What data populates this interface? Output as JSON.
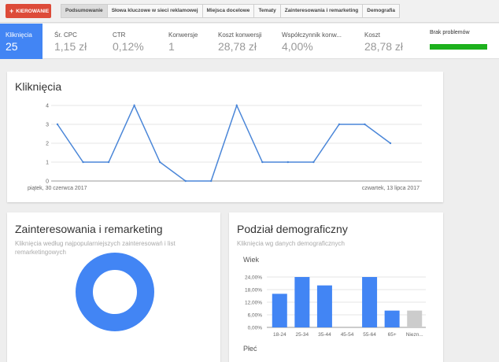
{
  "toolbar": {
    "primary_button": "KIEROWANIE",
    "tabs": [
      {
        "label": "Podsumowanie",
        "active": true
      },
      {
        "label": "Słowa kluczowe w sieci reklamowej",
        "active": false
      },
      {
        "label": "Miejsca docelowe",
        "active": false
      },
      {
        "label": "Tematy",
        "active": false
      },
      {
        "label": "Zainteresowania i remarketing",
        "active": false
      },
      {
        "label": "Demografia",
        "active": false
      }
    ]
  },
  "metrics": [
    {
      "label": "Kliknięcia",
      "value": "25",
      "selected": true
    },
    {
      "label": "Śr. CPC",
      "value": "1,15 zł"
    },
    {
      "label": "CTR",
      "value": "0,12%"
    },
    {
      "label": "Konwersje",
      "value": "1"
    },
    {
      "label": "Koszt konwersji",
      "value": "28,78 zł"
    },
    {
      "label": "Współczynnik konw...",
      "value": "4,00%"
    },
    {
      "label": "Koszt",
      "value": "28,78 zł"
    }
  ],
  "status": {
    "label": "Brak problemów",
    "color": "#1db11d"
  },
  "clicks_card": {
    "title": "Kliknięcia",
    "start_label": "piątek, 30 czerwca 2017",
    "end_label": "czwartek, 13 lipca 2017"
  },
  "interests_card": {
    "title": "Zainteresowania i remarketing",
    "subtitle": "Kliknięcia według najpopularniejszych zainteresowań i list remarketingowych"
  },
  "demo_card": {
    "title": "Podział demograficzny",
    "subtitle": "Kliknięcia wg danych demograficznych",
    "age_label": "Wiek",
    "gender_label": "Płeć"
  },
  "chart_data": [
    {
      "type": "line",
      "title": "Kliknięcia",
      "x": [
        "2017-06-30",
        "2017-07-01",
        "2017-07-02",
        "2017-07-03",
        "2017-07-04",
        "2017-07-05",
        "2017-07-06",
        "2017-07-07",
        "2017-07-08",
        "2017-07-09",
        "2017-07-10",
        "2017-07-11",
        "2017-07-12",
        "2017-07-13"
      ],
      "series": [
        {
          "values": [
            3,
            1,
            1,
            4,
            1,
            0,
            0,
            4,
            1,
            1,
            1,
            3,
            3,
            2
          ],
          "color": "#4a86d8"
        }
      ],
      "yticks": [
        "0",
        "1",
        "2",
        "3",
        "4"
      ],
      "ylim": [
        0,
        4
      ],
      "grid": true
    },
    {
      "type": "bar",
      "title": "Wiek",
      "categories": [
        "18-24",
        "25-34",
        "35-44",
        "45-54",
        "55-64",
        "65+",
        "Niezn..."
      ],
      "values": [
        16,
        24,
        20,
        0,
        24,
        8,
        8
      ],
      "colors": [
        "#4285f4",
        "#4285f4",
        "#4285f4",
        "#4285f4",
        "#4285f4",
        "#4285f4",
        "#cccccc"
      ],
      "yticks": [
        "0,00%",
        "6,00%",
        "12,00%",
        "18,00%",
        "24,00%"
      ],
      "ylim": [
        0,
        24
      ],
      "grid": true
    }
  ]
}
